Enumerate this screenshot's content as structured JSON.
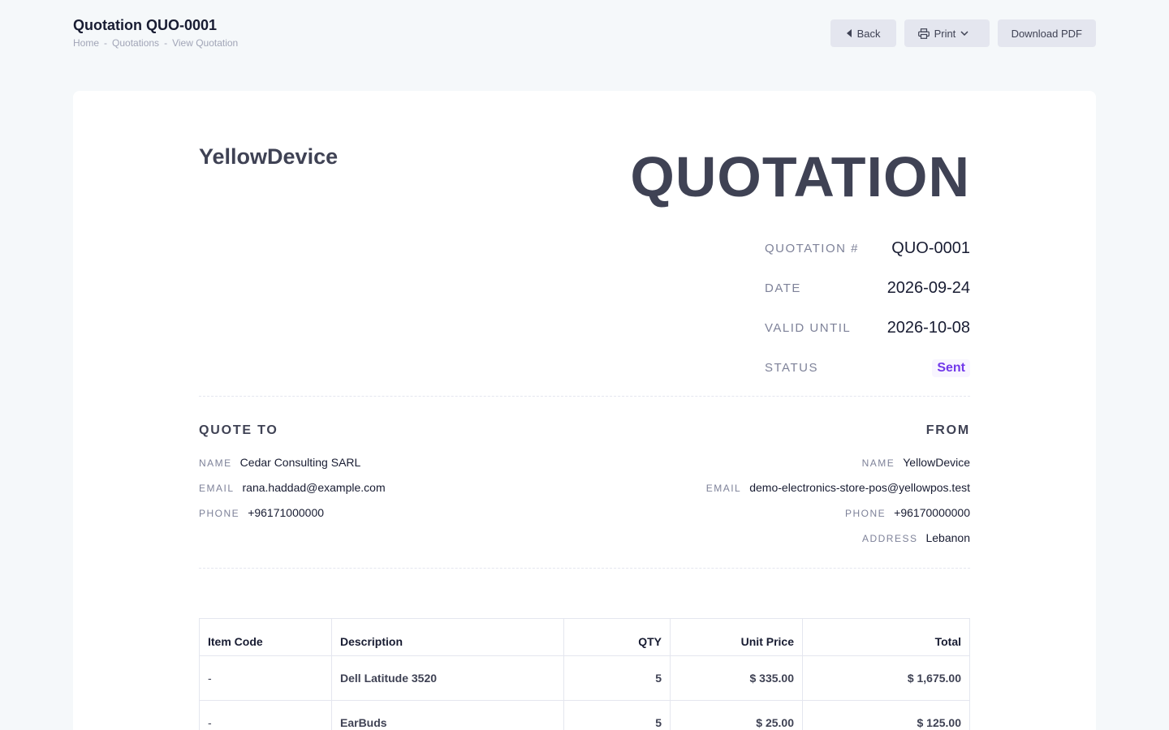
{
  "header": {
    "title": "Quotation QUO-0001",
    "breadcrumb": [
      "Home",
      "Quotations",
      "View Quotation"
    ],
    "breadcrumb_separator": "-",
    "actions": {
      "back_label": "Back",
      "print_label": "Print",
      "download_label": "Download PDF"
    }
  },
  "document": {
    "brand": "YellowDevice",
    "title": "QUOTATION",
    "meta": [
      {
        "label": "QUOTATION #",
        "value": "QUO-0001"
      },
      {
        "label": "DATE",
        "value": "2026-09-24"
      },
      {
        "label": "VALID UNTIL",
        "value": "2026-10-08"
      },
      {
        "label": "STATUS",
        "value": "Sent"
      }
    ],
    "status_color": "#7239ea",
    "quote_to": {
      "heading": "QUOTE TO",
      "rows": [
        {
          "label": "NAME",
          "value": "Cedar Consulting SARL"
        },
        {
          "label": "EMAIL",
          "value": "rana.haddad@example.com"
        },
        {
          "label": "PHONE",
          "value": "+96171000000"
        }
      ]
    },
    "from": {
      "heading": "FROM",
      "rows": [
        {
          "label": "NAME",
          "value": "YellowDevice"
        },
        {
          "label": "EMAIL",
          "value": "demo-electronics-store-pos@yellowpos.test"
        },
        {
          "label": "PHONE",
          "value": "+96170000000"
        },
        {
          "label": "ADDRESS",
          "value": "Lebanon"
        }
      ]
    },
    "table": {
      "columns": [
        "Item Code",
        "Description",
        "QTY",
        "Unit Price",
        "Total"
      ],
      "rows": [
        {
          "code": "-",
          "description": "Dell Latitude 3520",
          "qty": "5",
          "unit_price": "$ 335.00",
          "total": "$ 1,675.00"
        },
        {
          "code": "-",
          "description": "EarBuds",
          "qty": "5",
          "unit_price": "$ 25.00",
          "total": "$ 125.00"
        }
      ]
    }
  }
}
